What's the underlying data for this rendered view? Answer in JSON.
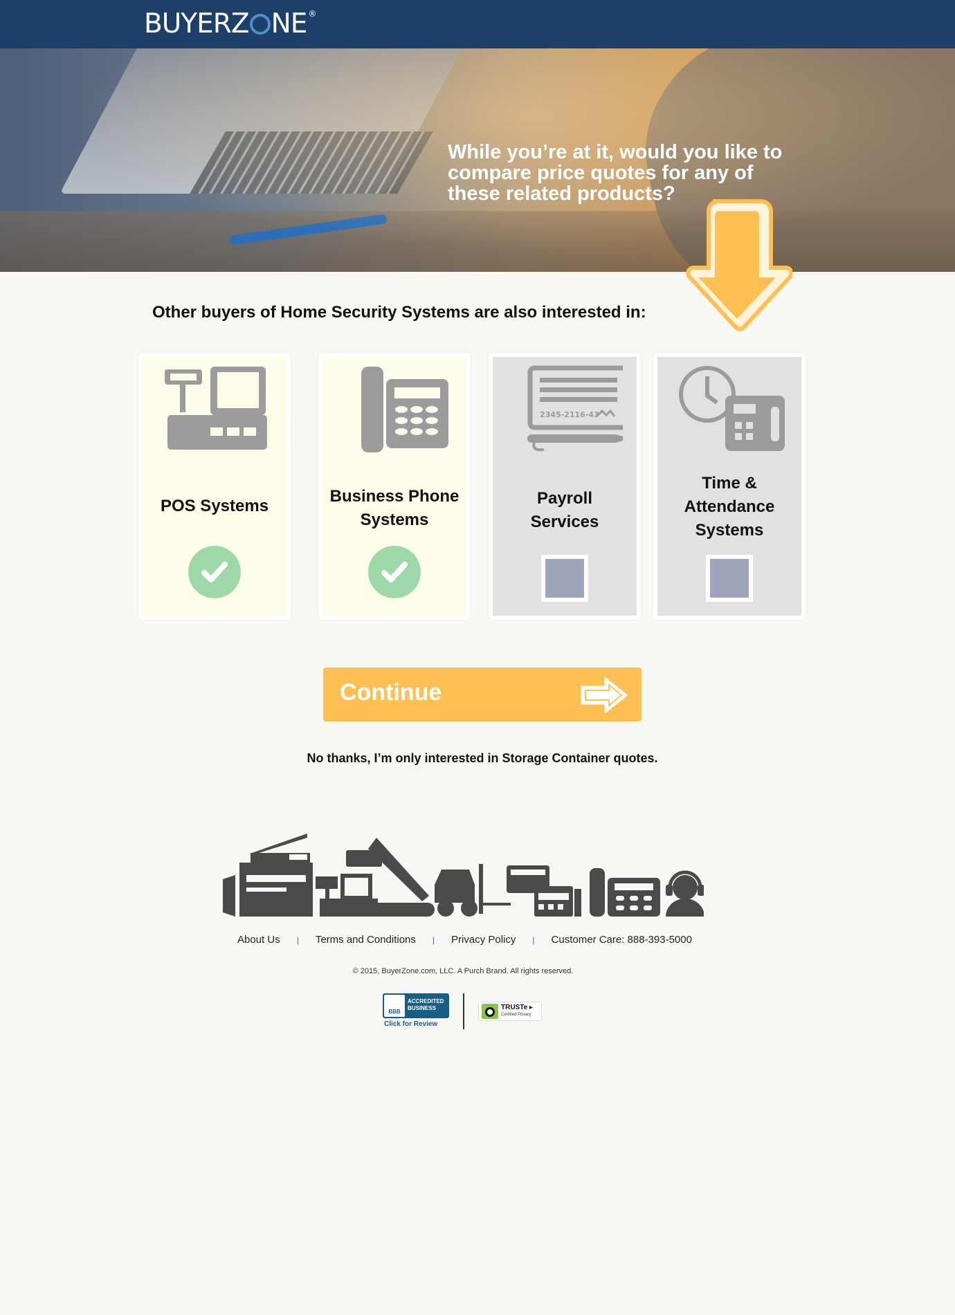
{
  "header": {
    "logo_text": "BUYERZ",
    "logo_text_end": "NE",
    "logo_reg": "®"
  },
  "hero": {
    "line1": "While you’re at it, would you like to",
    "line2": "compare price quotes for any of",
    "line3": "these related products?"
  },
  "main": {
    "subheading": "Other buyers of Home Security Systems are also interested in:",
    "cards": [
      {
        "title_line1": "POS Systems",
        "title_line2": "",
        "title_line3": "",
        "selected": true,
        "icon": "pos-terminal-icon"
      },
      {
        "title_line1": "Business Phone",
        "title_line2": "Systems",
        "title_line3": "",
        "selected": true,
        "icon": "office-phone-icon"
      },
      {
        "title_line1": "Payroll",
        "title_line2": "Services",
        "title_line3": "",
        "selected": false,
        "icon": "paycheck-icon",
        "check_text": "2345-2116-43"
      },
      {
        "title_line1": "Time &",
        "title_line2": "Attendance",
        "title_line3": "Systems",
        "selected": false,
        "icon": "time-clock-icon"
      }
    ],
    "continue_label": "Continue",
    "no_thanks": "No thanks, I’m only interested in Storage Container quotes."
  },
  "footer": {
    "links": [
      "About Us",
      "Terms and Conditions",
      "Privacy Policy",
      "Customer Care: 888-393-5000"
    ],
    "separator": "|",
    "copyright": "© 2015, BuyerZone.com, LLC. A Purch Brand. All rights reserved.",
    "bbb_logo_text": "BBB",
    "bbb_accredited": "ACCREDITED",
    "bbb_business": "BUSINESS",
    "bbb_review": "Click for Review",
    "truste_name": "TRUSTe ▸",
    "truste_sub": "Certified Privacy"
  },
  "colors": {
    "header_bg": "#1c4069",
    "accent": "#fec052",
    "selected_card": "#fdfde9",
    "unselected_card": "#e1e1e1",
    "check_green": "#9fd8a8",
    "checkbox": "#9ea5ba"
  }
}
